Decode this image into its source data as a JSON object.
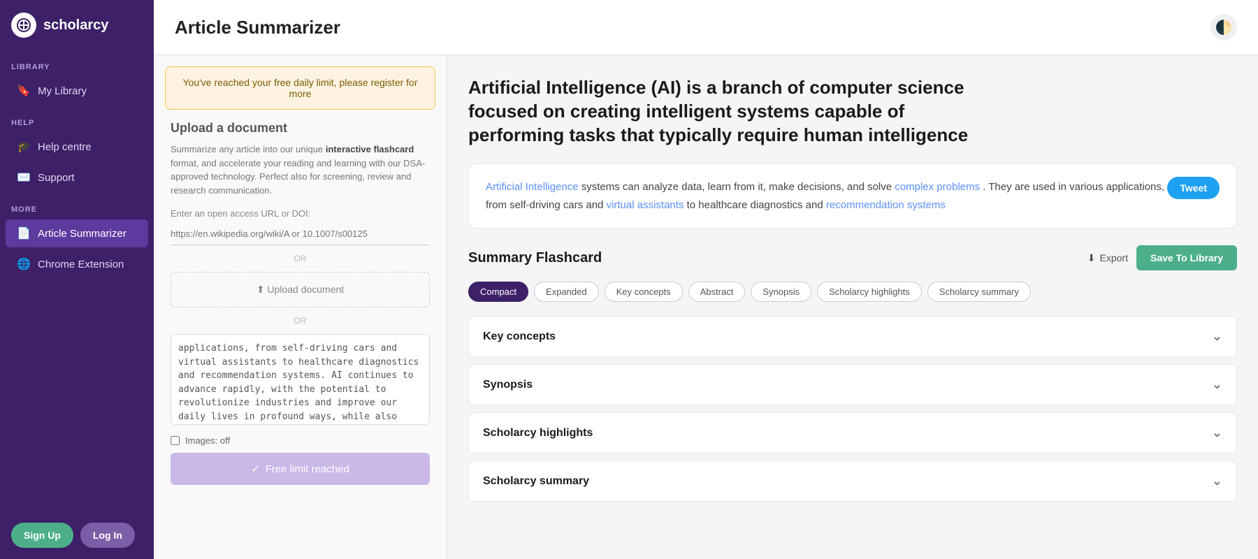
{
  "app": {
    "name": "scholarcy",
    "logo_char": "S",
    "title": "Article Summarizer"
  },
  "sidebar": {
    "library_label": "LIBRARY",
    "my_library": "My Library",
    "help_label": "HELP",
    "help_centre": "Help centre",
    "support": "Support",
    "more_label": "MORE",
    "article_summarizer": "Article Summarizer",
    "chrome_extension": "Chrome Extension",
    "signup_label": "Sign Up",
    "login_label": "Log In"
  },
  "alert": {
    "message": "You've reached your free daily limit, please register for more"
  },
  "upload": {
    "title": "Upload a document",
    "description_start": "Summarize any article into our unique ",
    "description_bold": "interactive flashcard",
    "description_end": " format, and accelerate your reading and learning with our DSA-approved technology. Perfect also for screening, review and research communication.",
    "url_label": "Enter an open access URL or DOI:",
    "url_placeholder": "https://en.wikipedia.org/wiki/A or 10.1007/s00125",
    "or_label": "OR",
    "upload_btn": "Upload document",
    "images_label": "Images: off",
    "free_limit_label": "Free limit reached",
    "pasted_text": "applications, from self-driving cars and virtual assistants to healthcare diagnostics and recommendation systems. AI continues to advance rapidly, with the potential to revolutionize industries and improve our daily lives in profound ways, while also raising ethical and societal questions."
  },
  "article": {
    "title": "Artificial Intelligence (AI) is a branch of computer science focused on creating intelligent systems capable of performing tasks that typically require human intelligence",
    "summary_text": " systems can analyze data, learn from it, make decisions, and solve ",
    "summary_link1": "Artificial Intelligence",
    "summary_link2": "complex problems",
    "summary_link3": "virtual assistants",
    "summary_link4": "recommendation systems",
    "summary_part1": " systems can analyze data, learn from it, make decisions, and solve ",
    "summary_part2": ". They are used in various applications, from self-driving cars and ",
    "summary_part3": " to healthcare diagnostics and ",
    "tweet_label": "Tweet"
  },
  "flashcard": {
    "title": "Summary Flashcard",
    "export_label": "Export",
    "save_label": "Save To Library"
  },
  "tabs": [
    {
      "label": "Compact",
      "active": true
    },
    {
      "label": "Expanded",
      "active": false
    },
    {
      "label": "Key concepts",
      "active": false
    },
    {
      "label": "Abstract",
      "active": false
    },
    {
      "label": "Synopsis",
      "active": false
    },
    {
      "label": "Scholarcy highlights",
      "active": false
    },
    {
      "label": "Scholarcy summary",
      "active": false
    }
  ],
  "accordion": [
    {
      "label": "Key concepts"
    },
    {
      "label": "Synopsis"
    },
    {
      "label": "Scholarcy highlights"
    },
    {
      "label": "Scholarcy summary"
    }
  ],
  "theme_icon": "🌓"
}
